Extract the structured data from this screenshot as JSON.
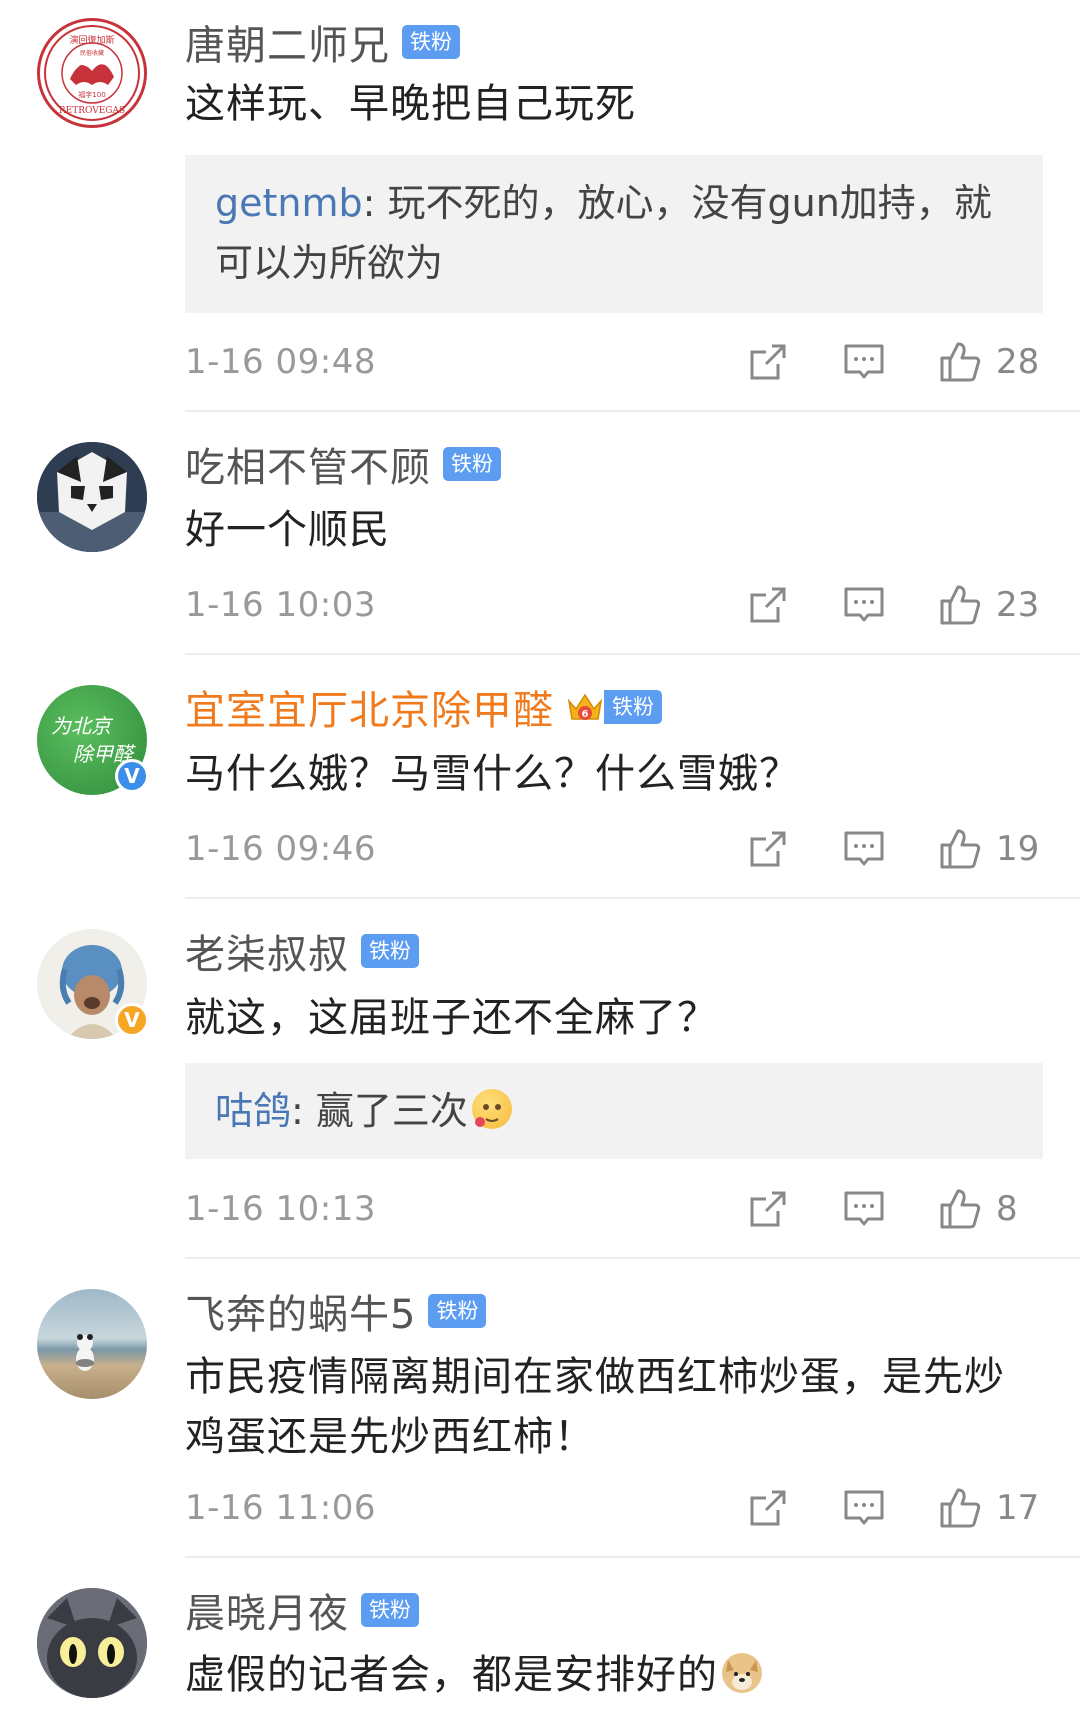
{
  "comments": [
    {
      "user": "唐朝二师兄",
      "badge": "铁粉",
      "text": "这样玩、早晚把自己玩死",
      "reply": {
        "name": "getnmb",
        "sep": ": ",
        "text": "玩不死的，放心，没有gun加持，就可以为所欲为"
      },
      "time": "1-16 09:48",
      "likes": "28"
    },
    {
      "user": "吃相不管不顾",
      "badge": "铁粉",
      "text": "好一个顺民",
      "time": "1-16 10:03",
      "likes": "23"
    },
    {
      "user": "宜室宜厅北京除甲醛",
      "badge": "铁粉",
      "vip_level": "6",
      "verified": "V",
      "text": "马什么娥？马雪什么？什么雪娥？",
      "time": "1-16 09:46",
      "likes": "19"
    },
    {
      "user": "老柒叔叔",
      "badge": "铁粉",
      "verified": "V",
      "text": "就这，这届班子还不全麻了？",
      "reply": {
        "name": "咕鸽",
        "sep": ": ",
        "text": "赢了三次"
      },
      "time": "1-16 10:13",
      "likes": "8"
    },
    {
      "user": "飞奔的蜗牛5",
      "badge": "铁粉",
      "text": "市民疫情隔离期间在家做西红柿炒蛋，是先炒鸡蛋还是先炒西红柿！",
      "time": "1-16 11:06",
      "likes": "17"
    },
    {
      "user": "晨晓月夜",
      "badge": "铁粉",
      "text": "虚假的记者会，都是安排好的"
    }
  ],
  "avatar_texts": {
    "c1_top": "演回復加斯",
    "c1_mid": "民俗收藏",
    "c1_num": "福字100",
    "c1_bottom": "RETROVEGAS",
    "c3_line1": "为北京",
    "c3_line2": "除甲醛"
  },
  "colors": {
    "badge": "#5c9df2",
    "vip_name": "#f07a1c",
    "reply_name": "#4a78b4",
    "meta": "#999999"
  },
  "icons": [
    "share-icon",
    "comment-icon",
    "thumbs-up-icon"
  ]
}
